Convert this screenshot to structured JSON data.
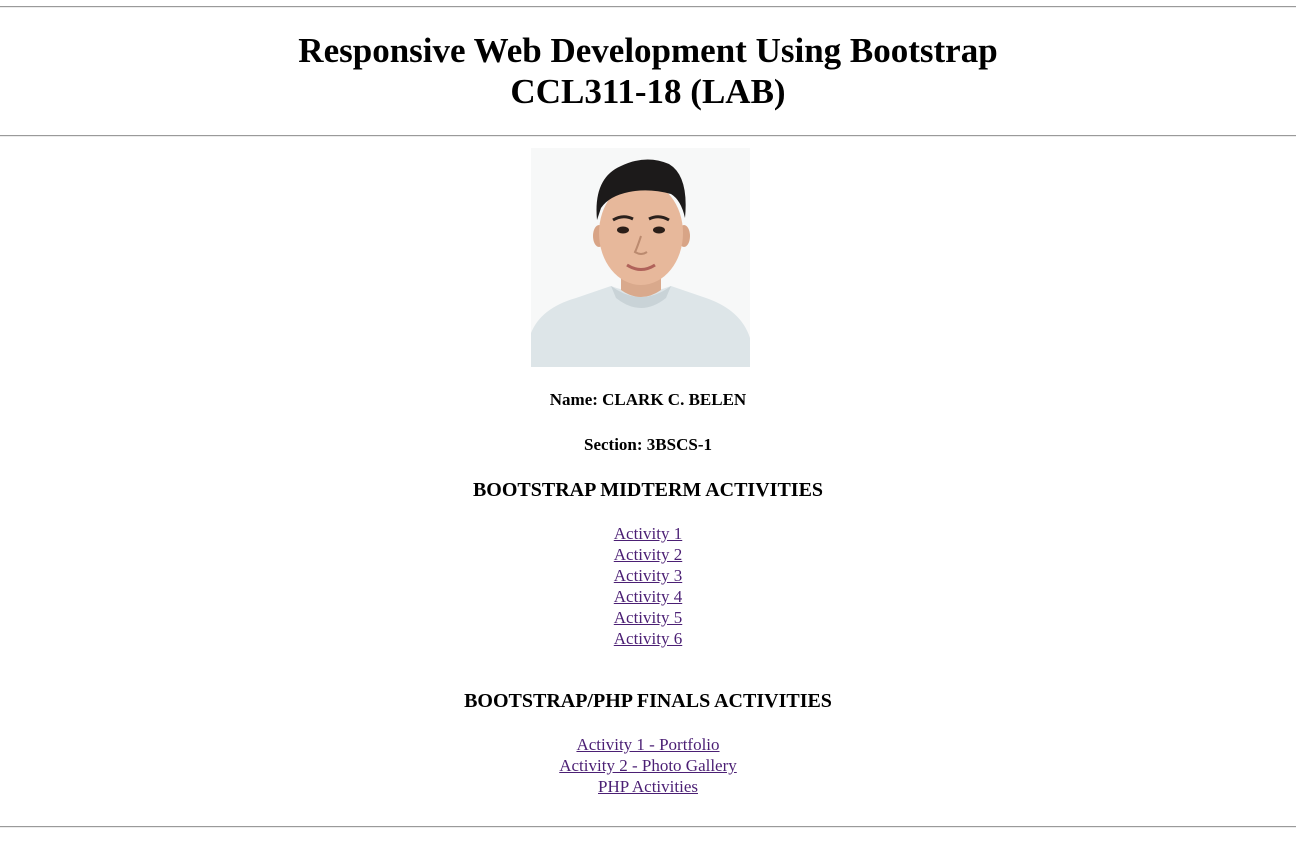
{
  "header": {
    "title_line1": "Responsive Web Development Using Bootstrap",
    "title_line2": "CCL311-18 (LAB)"
  },
  "profile": {
    "photo_alt": "Profile photo",
    "name": "Name: CLARK C. BELEN",
    "section": "Section: 3BSCS-1"
  },
  "midterm": {
    "heading": "BOOTSTRAP MIDTERM ACTIVITIES",
    "links": [
      "Activity 1",
      "Activity 2",
      "Activity 3",
      "Activity 4",
      "Activity 5",
      "Activity 6"
    ]
  },
  "finals": {
    "heading": "BOOTSTRAP/PHP FINALS ACTIVITIES",
    "links": [
      "Activity 1 - Portfolio",
      "Activity 2 - Photo Gallery",
      "PHP Activities"
    ]
  },
  "colors": {
    "link_visited": "#4b1f74",
    "rule": "#9a9a9a"
  }
}
